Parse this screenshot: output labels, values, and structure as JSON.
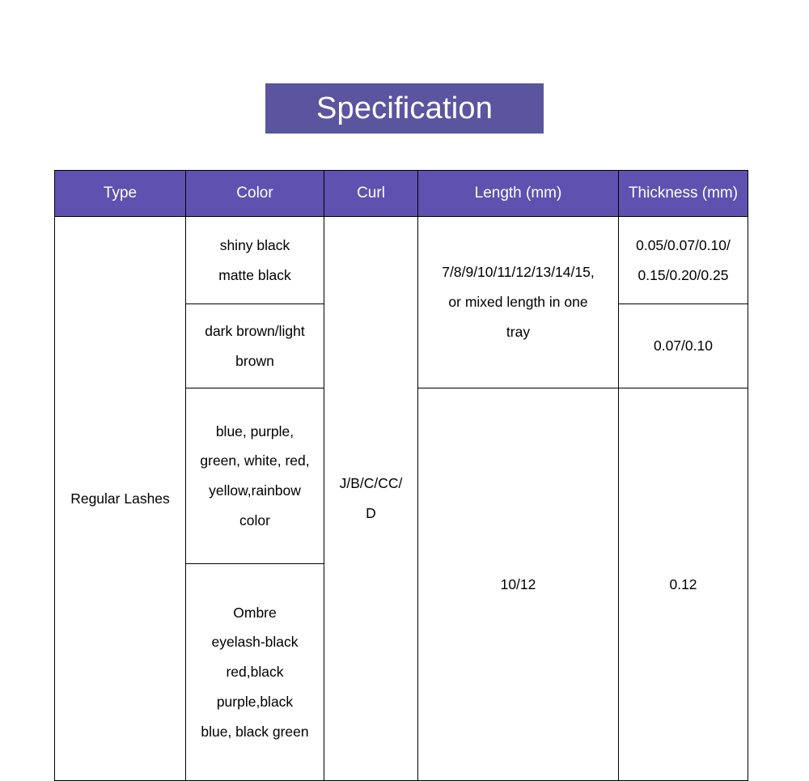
{
  "title": {
    "text": "Specification"
  },
  "colors": {
    "banner_purple": "#5b55a0",
    "header_purple": "#5f51b0",
    "header_text": "#ffffff",
    "body_text": "#000000",
    "border": "#000000",
    "background": "#ffffff"
  },
  "table": {
    "headers": [
      "Type",
      "Color",
      "Curl",
      "Length (mm)",
      "Thickness (mm)"
    ],
    "type_cell": "Regular Lashes",
    "curl_cell": {
      "line1": "J/B/C/CC/",
      "line2": "D"
    },
    "color_rows": [
      {
        "lines": [
          "shiny black",
          "matte black"
        ]
      },
      {
        "lines": [
          "dark brown/light",
          "brown"
        ]
      },
      {
        "lines": [
          "blue, purple,",
          "green, white, red,",
          "yellow,rainbow",
          "color"
        ]
      },
      {
        "lines": [
          "Ombre",
          "eyelash-black",
          "red,black",
          "purple,black",
          "blue, black green"
        ]
      }
    ],
    "length_rows": [
      {
        "lines": [
          "7/8/9/10/11/12/13/14/15,",
          "or mixed length in one",
          "tray"
        ]
      },
      {
        "lines": [
          "10/12"
        ]
      }
    ],
    "thickness_rows": [
      {
        "lines": [
          "0.05/0.07/0.10/",
          "0.15/0.20/0.25"
        ]
      },
      {
        "lines": [
          "0.07/0.10"
        ]
      },
      {
        "lines": [
          "0.12"
        ]
      }
    ]
  }
}
